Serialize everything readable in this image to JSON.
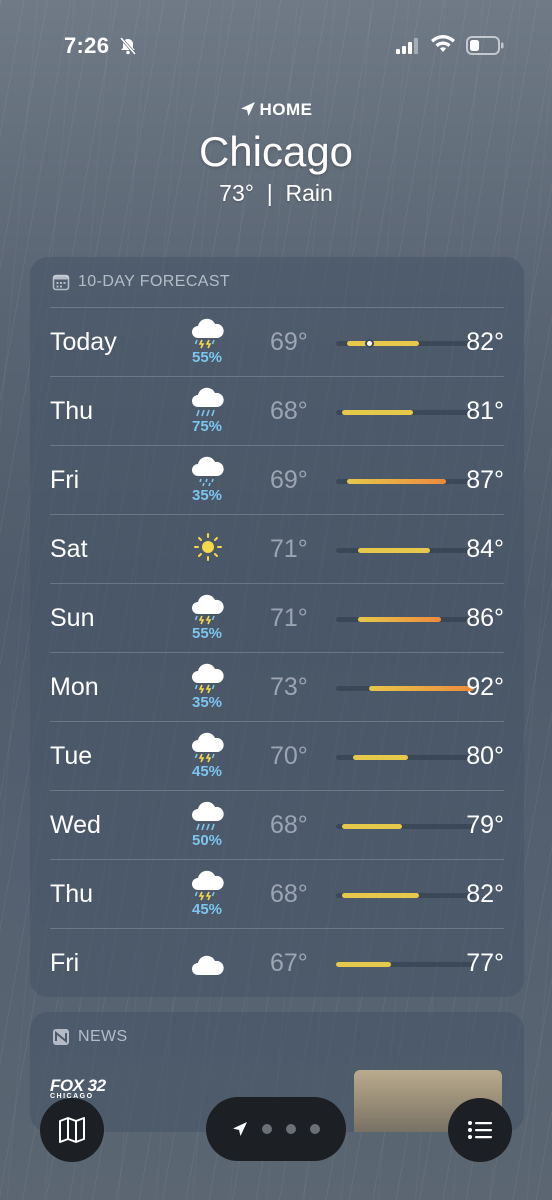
{
  "status_bar": {
    "time": "7:26",
    "icons": [
      "bell-slash-icon",
      "signal-icon",
      "wifi-icon",
      "battery-icon"
    ]
  },
  "header": {
    "location_label": "HOME",
    "city": "Chicago",
    "temp": "73°",
    "separator": "|",
    "condition": "Rain"
  },
  "forecast": {
    "title": "10-DAY FORECAST",
    "range_min": 67,
    "range_max": 92,
    "current_temp": 73,
    "days": [
      {
        "day": "Today",
        "icon": "thunderstorm-icon",
        "pop": "55%",
        "low": "69°",
        "high": "82°",
        "lo": 69,
        "hi": 82,
        "current": true
      },
      {
        "day": "Thu",
        "icon": "rain-icon",
        "pop": "75%",
        "low": "68°",
        "high": "81°",
        "lo": 68,
        "hi": 81
      },
      {
        "day": "Fri",
        "icon": "drizzle-icon",
        "pop": "35%",
        "low": "69°",
        "high": "87°",
        "lo": 69,
        "hi": 87
      },
      {
        "day": "Sat",
        "icon": "sun-icon",
        "pop": "",
        "low": "71°",
        "high": "84°",
        "lo": 71,
        "hi": 84
      },
      {
        "day": "Sun",
        "icon": "thunderstorm-icon",
        "pop": "55%",
        "low": "71°",
        "high": "86°",
        "lo": 71,
        "hi": 86
      },
      {
        "day": "Mon",
        "icon": "thunderstorm-icon",
        "pop": "35%",
        "low": "73°",
        "high": "92°",
        "lo": 73,
        "hi": 92
      },
      {
        "day": "Tue",
        "icon": "thunderstorm-icon",
        "pop": "45%",
        "low": "70°",
        "high": "80°",
        "lo": 70,
        "hi": 80
      },
      {
        "day": "Wed",
        "icon": "rain-icon",
        "pop": "50%",
        "low": "68°",
        "high": "79°",
        "lo": 68,
        "hi": 79
      },
      {
        "day": "Thu",
        "icon": "thunderstorm-icon",
        "pop": "45%",
        "low": "68°",
        "high": "82°",
        "lo": 68,
        "hi": 82
      },
      {
        "day": "Fri",
        "icon": "cloud-icon",
        "pop": "",
        "low": "67°",
        "high": "77°",
        "lo": 67,
        "hi": 77
      }
    ]
  },
  "news": {
    "title": "NEWS",
    "source_logo": "FOX 32",
    "source_logo_sub": "CHICAGO"
  },
  "bottom_bar": {
    "left_icon": "map-icon",
    "right_icon": "list-icon",
    "pager_icon": "location-arrow-icon",
    "page_dots": 3
  },
  "colors": {
    "bar_cool": "#e6c84a",
    "bar_warm": "#ee8a3c",
    "pop": "#7cc6ee"
  }
}
